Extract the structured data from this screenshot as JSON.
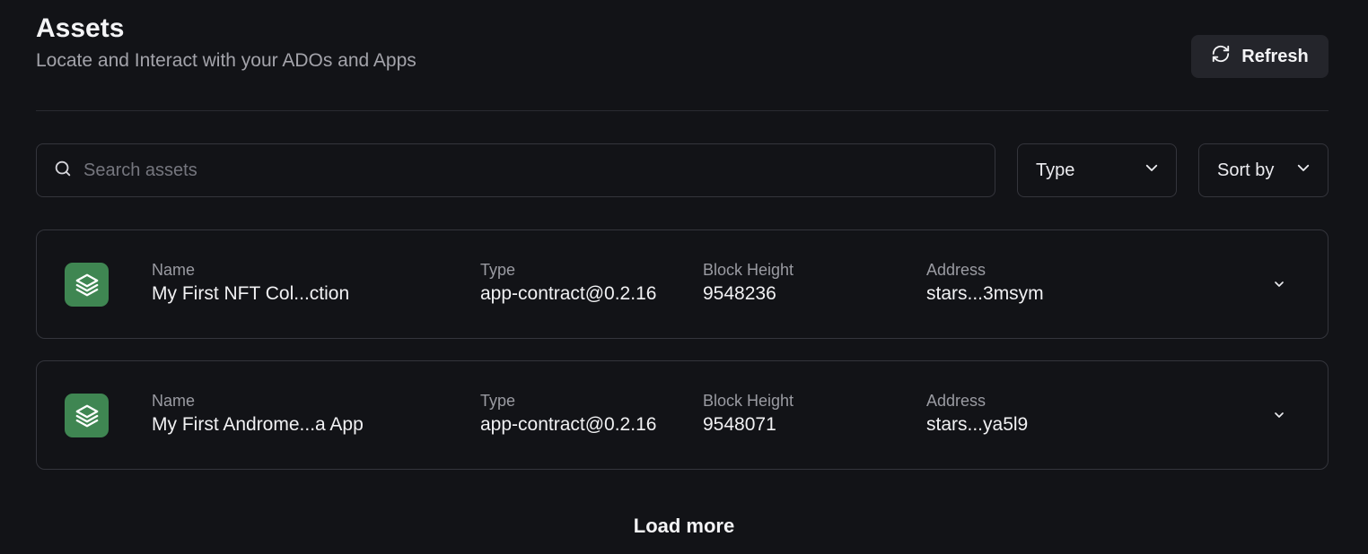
{
  "header": {
    "title": "Assets",
    "subtitle": "Locate and Interact with your ADOs and Apps",
    "refresh_label": "Refresh"
  },
  "toolbar": {
    "search_placeholder": "Search assets",
    "search_value": "",
    "type_label": "Type",
    "sort_label": "Sort by"
  },
  "columns": {
    "name": "Name",
    "type": "Type",
    "block_height": "Block Height",
    "address": "Address"
  },
  "assets": [
    {
      "name": "My First NFT Col...ction",
      "type": "app-contract@0.2.16",
      "block_height": "9548236",
      "address": "stars...3msym"
    },
    {
      "name": "My First Androme...a App",
      "type": "app-contract@0.2.16",
      "block_height": "9548071",
      "address": "stars...ya5l9"
    }
  ],
  "load_more_label": "Load more",
  "icons": {
    "refresh": "refresh-icon",
    "search": "search-icon",
    "dropdown": "chevron-down-icon",
    "app": "layers-icon"
  },
  "colors": {
    "background": "#121317",
    "card_border": "#34353c",
    "app_icon_bg": "#3f8652",
    "button_bg": "#24252b"
  }
}
